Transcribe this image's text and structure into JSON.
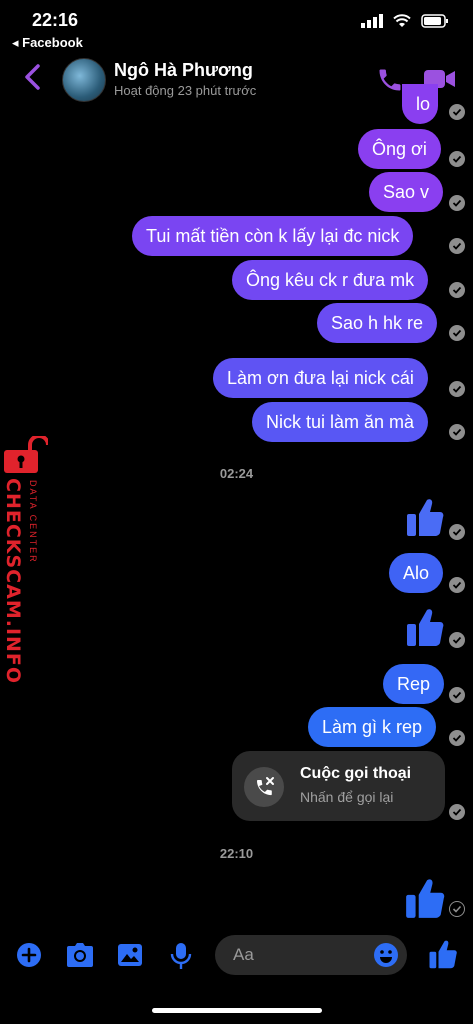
{
  "status_bar": {
    "time": "22:16",
    "back_app": "◂ Facebook"
  },
  "header": {
    "contact_name": "Ngô Hà Phương",
    "activity": "Hoạt động 23 phút trước"
  },
  "messages": [
    {
      "text": "lo"
    },
    {
      "text": "Ông ơi"
    },
    {
      "text": "Sao v"
    },
    {
      "text": "Tui mất tiền còn k lấy lại đc nick"
    },
    {
      "text": "Ông kêu ck r đưa mk"
    },
    {
      "text": "Sao h hk re"
    },
    {
      "text": "Làm ơn đưa lại nick cái"
    },
    {
      "text": "Nick tui làm ăn mà"
    },
    {
      "text": "Alo"
    },
    {
      "text": "Rep"
    },
    {
      "text": "Làm gì k rep"
    }
  ],
  "timestamps": [
    "02:24",
    "22:10"
  ],
  "call_card": {
    "title": "Cuộc gọi thoại",
    "subtitle": "Nhấn để gọi lại"
  },
  "composer": {
    "placeholder": "Aa"
  },
  "watermark": {
    "brand": "CHECKSCAM.INFO",
    "sub": "DATA CENTER"
  },
  "colors": {
    "purple": "#8a3ff0",
    "blue": "#2d6df5",
    "accent_violet": "#9b51e0",
    "tick_gray": "#8e8e8e"
  }
}
